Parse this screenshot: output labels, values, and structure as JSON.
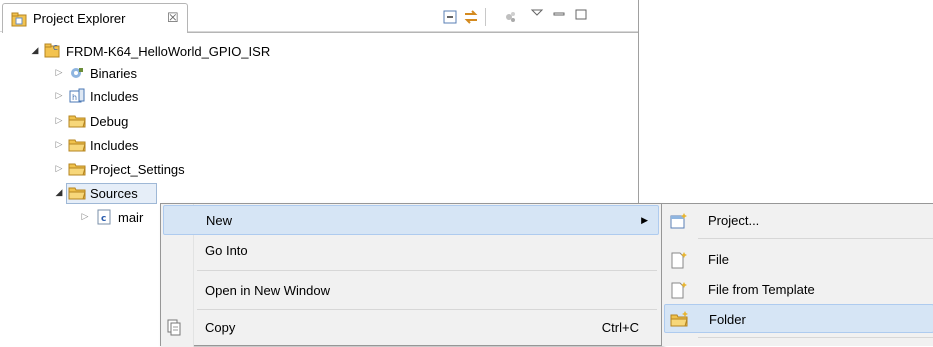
{
  "view": {
    "tab_title": "Project Explorer",
    "close_glyph": "☒"
  },
  "tree": {
    "project": "FRDM-K64_HelloWorld_GPIO_ISR",
    "items": [
      {
        "label": "Binaries",
        "icon": "binaries-icon"
      },
      {
        "label": "Includes",
        "icon": "includes-icon"
      },
      {
        "label": "Debug",
        "icon": "folder-icon"
      },
      {
        "label": "Includes",
        "icon": "folder-icon"
      },
      {
        "label": "Project_Settings",
        "icon": "folder-icon"
      },
      {
        "label": "Sources",
        "icon": "folder-open-icon"
      },
      {
        "label": "mair",
        "icon": "c-file-icon"
      }
    ]
  },
  "context_menu": {
    "items": [
      {
        "label": "New",
        "shortcut": ""
      },
      {
        "label": "Go Into",
        "shortcut": ""
      },
      {
        "label": "Open in New Window",
        "shortcut": ""
      },
      {
        "label": "Copy",
        "shortcut": "Ctrl+C"
      }
    ]
  },
  "submenu": {
    "items": [
      {
        "label": "Project..."
      },
      {
        "label": "File"
      },
      {
        "label": "File from Template"
      },
      {
        "label": "Folder"
      }
    ]
  },
  "colors": {
    "selection": "#d6e5f5",
    "folder": "#f0c24c"
  }
}
